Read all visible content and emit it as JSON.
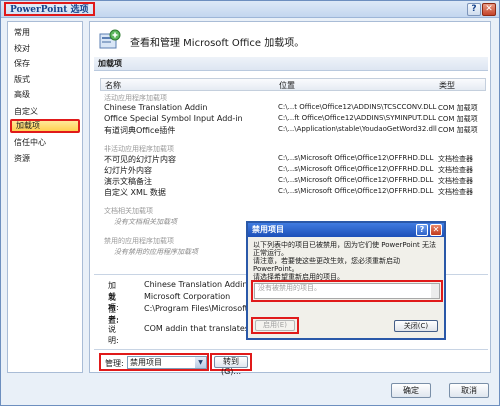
{
  "window": {
    "title": "PowerPoint 选项",
    "help": "?",
    "close": "✕"
  },
  "sidebar": {
    "items": [
      {
        "label": "常用"
      },
      {
        "label": "校对"
      },
      {
        "label": "保存"
      },
      {
        "label": "版式"
      },
      {
        "label": "高级"
      },
      {
        "label": "自定义"
      },
      {
        "label": "加载项"
      },
      {
        "label": "信任中心"
      },
      {
        "label": "资源"
      }
    ]
  },
  "main": {
    "header": "查看和管理 Microsoft Office 加载项。",
    "section": "加载项",
    "columns": {
      "name": "名称",
      "location": "位置",
      "type": "类型"
    },
    "groups": {
      "active": "活动应用程序加载项",
      "inactive": "非活动应用程序加载项",
      "document": "文档相关加载项",
      "doc_none": "没有文档相关加载项",
      "disabled": "禁用的应用程序加载项",
      "disabled_none": "没有禁用的应用程序加载项"
    },
    "active_rows": [
      {
        "name": "Chinese Translation Addin",
        "location": "C:\\...t Office\\Office12\\ADDINS\\TCSCCONV.DLL",
        "type": "COM 加载项"
      },
      {
        "name": "Office Special Symbol Input Add-in",
        "location": "C:\\...ft Office\\Office12\\ADDINS\\SYMINPUT.DLL",
        "type": "COM 加载项"
      },
      {
        "name": "有道词典Office插件",
        "location": "C:\\...\\Application\\stable\\YoudaoGetWord32.dll",
        "type": "COM 加载项"
      }
    ],
    "inactive_rows": [
      {
        "name": "不可见的幻灯片内容",
        "location": "C:\\...s\\Microsoft Office\\Office12\\OFFRHD.DLL",
        "type": "文档检查器"
      },
      {
        "name": "幻灯片外内容",
        "location": "C:\\...s\\Microsoft Office\\Office12\\OFFRHD.DLL",
        "type": "文档检查器"
      },
      {
        "name": "演示文稿备注",
        "location": "C:\\...s\\Microsoft Office\\Office12\\OFFRHD.DLL",
        "type": "文档检查器"
      },
      {
        "name": "自定义 XML 数据",
        "location": "C:\\...s\\Microsoft Office\\Office12\\OFFRHD.DLL",
        "type": "文档检查器"
      }
    ],
    "details": {
      "addin_label": "加载项:",
      "addin_value": "Chinese Translation Addin",
      "publisher_label": "发布者:",
      "publisher_value": "Microsoft Corporation",
      "location_label": "位置:",
      "location_value": "C:\\Program Files\\Microsoft Offic",
      "desc_label": "说明:",
      "desc_value": "COM addin that translates betw"
    },
    "manage_label": "管理:",
    "manage_value": "禁用项目",
    "goto_button": "转到(G)..."
  },
  "footer": {
    "ok": "确定",
    "cancel": "取消"
  },
  "dialog": {
    "title": "禁用项目",
    "help": "?",
    "close": "✕",
    "text1": "以下列表中的项目已被禁用，因为它们使 PowerPoint 无法",
    "text2": "正常运行。",
    "text3": "请注意，若要使这些更改生效，您必须重新启动",
    "text4": "PowerPoint。",
    "text5": "请选择希望重新启用的项目。",
    "list_placeholder": "没有被禁用的项目。",
    "enable_button": "启用(E)",
    "close_button": "关闭(C)"
  },
  "colors": {
    "highlight_red": "#e01a1a",
    "title_blue": "#15428b",
    "dialog_title_blue": "#2a58a8"
  }
}
